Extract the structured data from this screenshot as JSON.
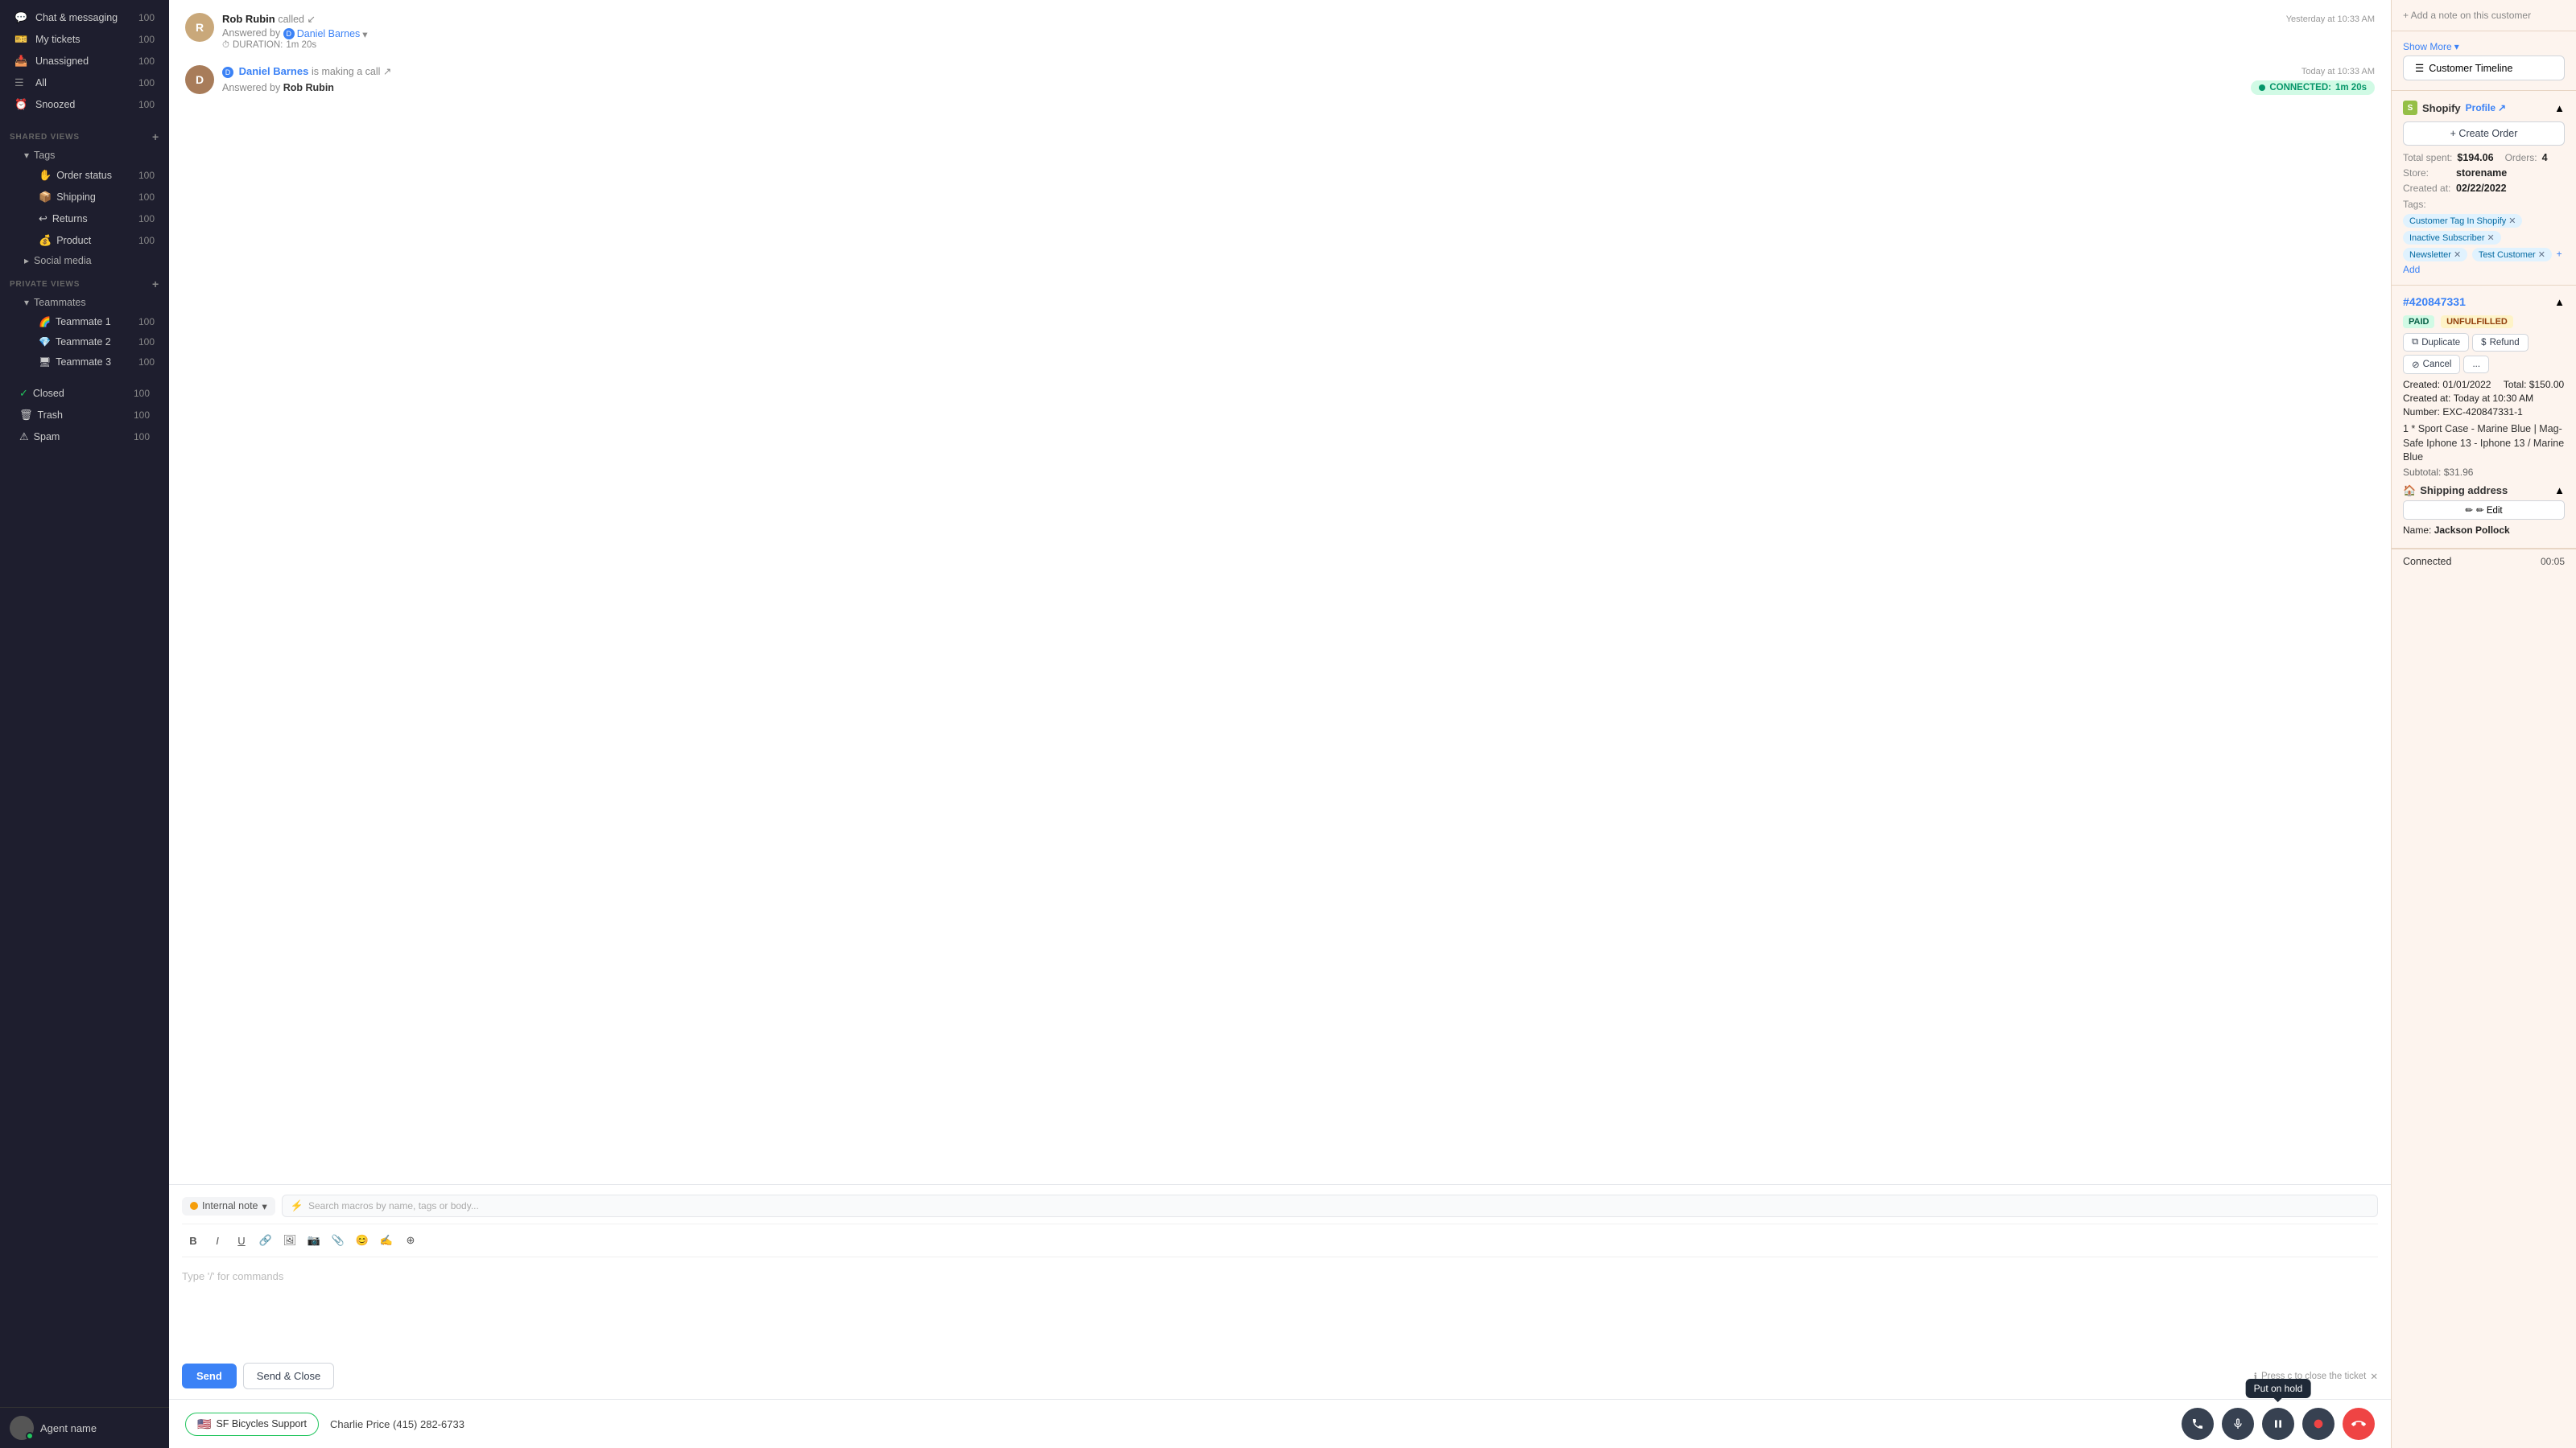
{
  "sidebar": {
    "nav_items": [
      {
        "id": "chat-messaging",
        "label": "Chat & messaging",
        "count": "100",
        "icon": "💬"
      },
      {
        "id": "my-tickets",
        "label": "My tickets",
        "count": "100",
        "icon": "🎫"
      },
      {
        "id": "unassigned",
        "label": "Unassigned",
        "count": "100",
        "icon": "📥"
      },
      {
        "id": "all",
        "label": "All",
        "count": "100",
        "icon": "☰"
      },
      {
        "id": "snoozed",
        "label": "Snoozed",
        "count": "100",
        "icon": "⏰"
      }
    ],
    "shared_views_label": "SHARED VIEWS",
    "tags_label": "Tags",
    "tag_items": [
      {
        "id": "order-status",
        "label": "Order status",
        "count": "100",
        "color": "#f59e0b",
        "emoji": "✋"
      },
      {
        "id": "shipping",
        "label": "Shipping",
        "count": "100",
        "color": "#8b5cf6",
        "emoji": "📦"
      },
      {
        "id": "returns",
        "label": "Returns",
        "count": "100",
        "color": "#6b7280",
        "emoji": "↩"
      },
      {
        "id": "product",
        "label": "Product",
        "count": "100",
        "color": "#f59e0b",
        "emoji": "💰"
      }
    ],
    "social_media_label": "Social media",
    "private_views_label": "PRIVATE VIEWS",
    "teammates_label": "Teammates",
    "teammate_items": [
      {
        "id": "teammate-1",
        "label": "Teammate 1",
        "count": "100",
        "color": "#ec4899"
      },
      {
        "id": "teammate-2",
        "label": "Teammate 2",
        "count": "100",
        "color": "#3b82f6"
      },
      {
        "id": "teammate-3",
        "label": "Teammate 3",
        "count": "100",
        "color": "#8b5cf6"
      }
    ],
    "bottom_items": [
      {
        "id": "closed",
        "label": "Closed",
        "count": "100",
        "icon": "✓"
      },
      {
        "id": "trash",
        "label": "Trash",
        "count": "100",
        "icon": "🗑"
      },
      {
        "id": "spam",
        "label": "Spam",
        "count": "100",
        "icon": "⚠"
      }
    ],
    "agent_name": "Agent name"
  },
  "conversation": {
    "items": [
      {
        "id": "call-1",
        "name": "Rob Rubin",
        "action": "called",
        "action_icon": "↙",
        "time": "Yesterday at 10:33 AM",
        "answered_by_label": "Answered by",
        "answered_by": "Daniel Barnes",
        "duration_label": "DURATION:",
        "duration": "1m 20s"
      },
      {
        "id": "call-2",
        "name": "Daniel Barnes",
        "action": "is making a call",
        "action_icon": "↗",
        "time": "Today at 10:33 AM",
        "answered_by_label": "Answered by",
        "answered_by": "Rob Rubin",
        "connected_label": "CONNECTED:",
        "connected_time": "1m 20s"
      }
    ]
  },
  "reply": {
    "type_label": "Internal note",
    "macro_placeholder": "Search macros by name, tags or body...",
    "text_placeholder": "Type '/' for commands",
    "send_label": "Send",
    "send_close_label": "Send & Close",
    "press_hint": "Press c to close the ticket"
  },
  "right_panel": {
    "shopify_label": "Shopify",
    "profile_label": "Profile",
    "create_order_label": "+ Create Order",
    "total_spent_label": "Total spent:",
    "total_spent": "$194.06",
    "orders_label": "Orders:",
    "orders_count": "4",
    "store_label": "Store:",
    "store_name": "storename",
    "created_at_label": "Created at:",
    "created_at": "02/22/2022",
    "tags_label": "Tags:",
    "tags": [
      {
        "label": "Customer Tag In Shopify",
        "type": "blue"
      },
      {
        "label": "Inactive Subscriber",
        "type": "blue"
      },
      {
        "label": "Newsletter",
        "type": "blue"
      },
      {
        "label": "Test Customer",
        "type": "blue"
      }
    ],
    "add_tag_label": "+ Add",
    "show_more_label": "Show More",
    "customer_timeline_label": "Customer Timeline",
    "order_id": "#420847331",
    "badge_paid": "PAID",
    "badge_unfulfilled": "UNFULFILLED",
    "duplicate_label": "Duplicate",
    "refund_label": "Refund",
    "cancel_label": "Cancel",
    "more_label": "...",
    "created_date_label": "Created:",
    "created_date": "01/01/2022",
    "total_label": "Total:",
    "total": "$150.00",
    "created_at2_label": "Created at:",
    "created_at2": "Today at 10:30 AM",
    "number_label": "Number:",
    "number": "EXC-420847331-1",
    "product_line": "1 * Sport Case - Marine Blue | Mag-Safe Iphone 13 - Iphone 13 / Marine Blue",
    "subtotal_label": "Subtotal:",
    "subtotal": "$31.96",
    "shipping_label": "Shipping address",
    "edit_label": "✏ Edit",
    "name_label": "Name:",
    "name": "Jackson Pollock",
    "connected_label": "Connected",
    "connected_time": "00:05"
  },
  "call_bar": {
    "channel_flag": "🇺🇸",
    "channel_name": "SF Bicycles Support",
    "caller_name": "Charlie Price",
    "caller_phone": "(415) 282-6733",
    "hold_tooltip": "Put on hold"
  }
}
